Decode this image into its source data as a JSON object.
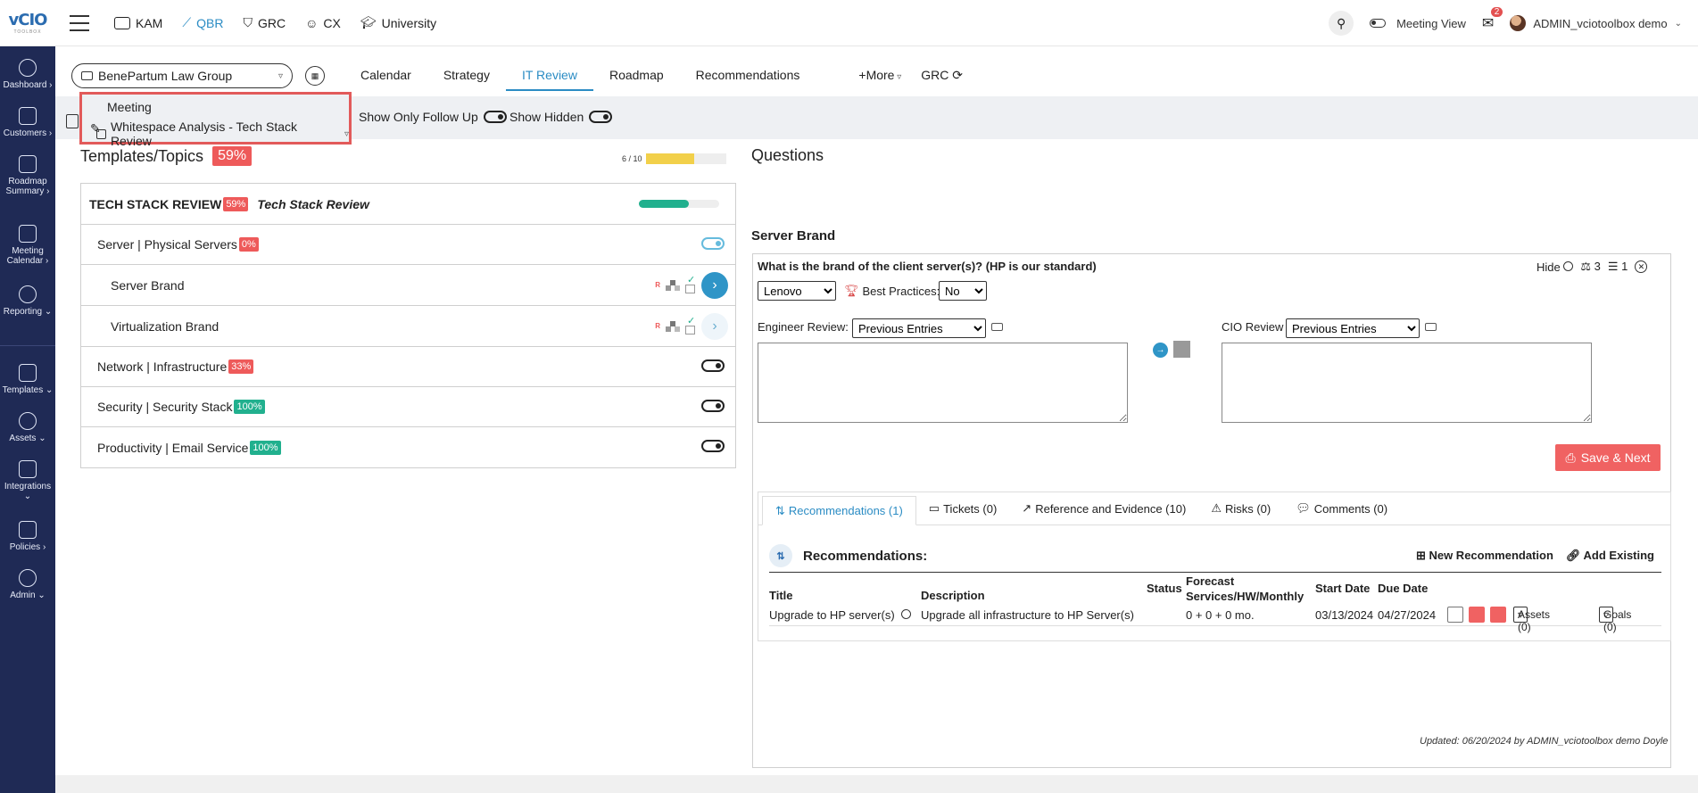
{
  "logo": {
    "text": "vCIO",
    "sub": "TOOLBOX"
  },
  "topnav": [
    {
      "label": "KAM",
      "icon": "id-card-icon"
    },
    {
      "label": "QBR",
      "icon": "chart-line-icon",
      "active": true
    },
    {
      "label": "GRC",
      "icon": "shield-icon"
    },
    {
      "label": "CX",
      "icon": "smiley-icon"
    },
    {
      "label": "University",
      "icon": "graduation-cap-icon"
    }
  ],
  "topright": {
    "meeting_view": "Meeting View",
    "mail_count": "2",
    "user": "ADMIN_vciotoolbox demo"
  },
  "sidebar": [
    {
      "label": "Dashboard ›"
    },
    {
      "label": "Customers ›"
    },
    {
      "label": "Roadmap Summary ›"
    },
    {
      "label": "Meeting Calendar ›"
    },
    {
      "label": "Reporting ⌄"
    },
    {
      "label": "Templates ⌄"
    },
    {
      "label": "Assets ⌄"
    },
    {
      "label": "Integrations ⌄"
    },
    {
      "label": "Policies ›"
    },
    {
      "label": "Admin ⌄"
    }
  ],
  "client": "BenePartum Law Group",
  "tabs": [
    "Calendar",
    "Strategy",
    "IT Review",
    "Roadmap",
    "Recommendations",
    "+More",
    "GRC"
  ],
  "meeting": {
    "label": "Meeting",
    "value": "Whitespace Analysis - Tech Stack Review"
  },
  "toggles": {
    "follow_up": "Show Only Follow Up",
    "hidden": "Show Hidden"
  },
  "templates": {
    "title": "Templates/Topics",
    "pct": "59%",
    "progress_text": "6 / 10",
    "progress_fraction": 0.6,
    "head": {
      "title": "TECH STACK REVIEW",
      "pct": "59%",
      "subtitle": "Tech Stack Review",
      "bar_fraction": 0.62
    },
    "rows": [
      {
        "type": "topic",
        "label": "Server | Physical Servers",
        "pct": "0%",
        "pct_color": "red"
      },
      {
        "type": "sub",
        "label": "Server Brand",
        "active": true
      },
      {
        "type": "sub",
        "label": "Virtualization Brand",
        "active": false
      },
      {
        "type": "topic",
        "label": "Network | Infrastructure",
        "pct": "33%",
        "pct_color": "red"
      },
      {
        "type": "topic",
        "label": "Security | Security Stack",
        "pct": "100%",
        "pct_color": "green"
      },
      {
        "type": "topic",
        "label": "Productivity | Email Service",
        "pct": "100%",
        "pct_color": "green"
      }
    ]
  },
  "questions": {
    "title": "Questions",
    "section": "Server Brand",
    "question": "What is the brand of the client server(s)? (HP is our standard)",
    "hide": "Hide",
    "weight": "3",
    "order": "1",
    "answer": "Lenovo",
    "best_practices_label": "Best Practices:",
    "best_practices": "No",
    "engineer_label": "Engineer Review:",
    "engineer_select": "Previous Entries",
    "cio_label": "CIO Review",
    "cio_select": "Previous Entries",
    "save": "Save & Next"
  },
  "rtabs": [
    "Recommendations (1)",
    "Tickets (0)",
    "Reference and Evidence (10)",
    "Risks (0)",
    "Comments (0)"
  ],
  "recommendations": {
    "heading": "Recommendations:",
    "new": "New Recommendation",
    "add": "Add Existing",
    "columns": {
      "title": "Title",
      "description": "Description",
      "status": "Status",
      "forecast": "Forecast Services/HW/Monthly",
      "start": "Start Date",
      "due": "Due Date"
    },
    "row": {
      "title": "Upgrade to HP server(s)",
      "description": "Upgrade all infrastructure to HP Server(s)",
      "forecast": "0 + 0 + 0 mo.",
      "start": "03/13/2024",
      "due": "04/27/2024",
      "assets": "Assets (0)",
      "goals": "Goals (0)"
    }
  },
  "updated": "Updated: 06/20/2024 by ADMIN_vciotoolbox demo Doyle"
}
